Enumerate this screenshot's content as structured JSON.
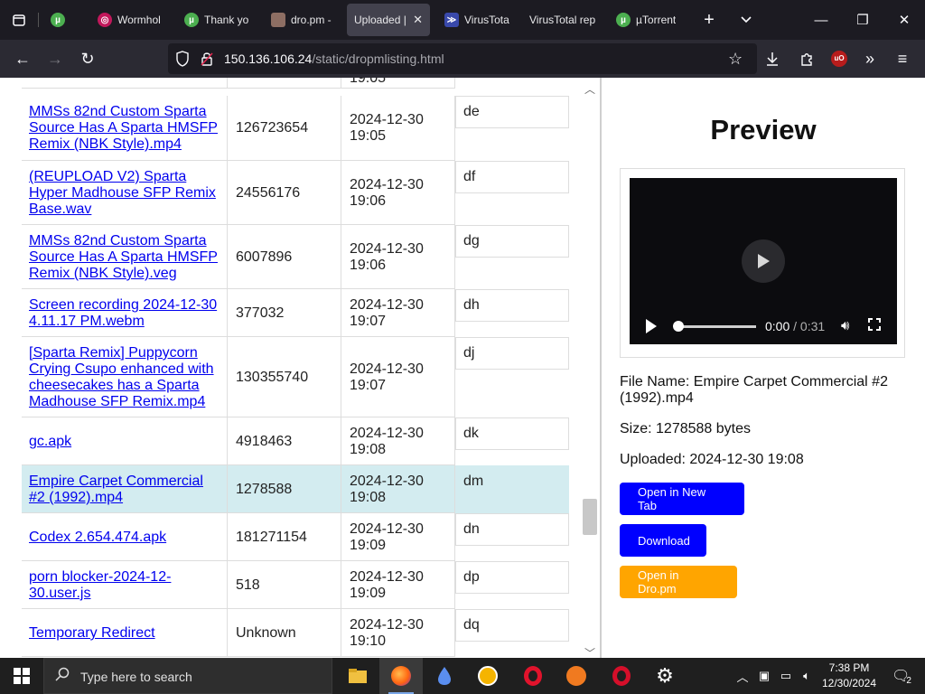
{
  "browser": {
    "tabs": [
      {
        "label": "",
        "icon": "utorrent-icon"
      },
      {
        "label": "Wormhol",
        "icon": "wormhole-icon"
      },
      {
        "label": "Thank yo",
        "icon": "utorrent-icon"
      },
      {
        "label": "dro.pm -",
        "icon": "dro-icon"
      },
      {
        "label": "Uploaded |",
        "icon": "",
        "active": true
      },
      {
        "label": "VirusTotal",
        "icon": "virustotal-icon"
      },
      {
        "label": "VirusTotal rep",
        "icon": ""
      },
      {
        "label": "µTorrent",
        "icon": "utorrent-icon"
      }
    ],
    "url": {
      "host": "150.136.106.24",
      "path": "/static/dropmlisting.html"
    }
  },
  "listing": {
    "partial_top": {
      "date": "19:05"
    },
    "rows": [
      {
        "name": "MMSs 82nd Custom Sparta Source Has A Sparta HMSFP Remix (NBK Style).mp4",
        "size": "126723654",
        "date": "2024-12-30 19:05",
        "id": "de"
      },
      {
        "name": "(REUPLOAD V2) Sparta Hyper Madhouse SFP Remix Base.wav",
        "size": "24556176",
        "date": "2024-12-30 19:06",
        "id": "df"
      },
      {
        "name": "MMSs 82nd Custom Sparta Source Has A Sparta HMSFP Remix (NBK Style).veg",
        "size": "6007896",
        "date": "2024-12-30 19:06",
        "id": "dg"
      },
      {
        "name": "Screen recording 2024-12-30 4.11.17 PM.webm",
        "size": "377032",
        "date": "2024-12-30 19:07",
        "id": "dh"
      },
      {
        "name": "[Sparta Remix] Puppycorn Crying Csupo enhanced with cheesecakes has a Sparta Madhouse SFP Remix.mp4",
        "size": "130355740",
        "date": "2024-12-30 19:07",
        "id": "dj"
      },
      {
        "name": "gc.apk",
        "size": "4918463",
        "date": "2024-12-30 19:08",
        "id": "dk"
      },
      {
        "name": "Empire Carpet Commercial #2 (1992).mp4",
        "size": "1278588",
        "date": "2024-12-30 19:08",
        "id": "dm",
        "selected": true
      },
      {
        "name": "Codex 2.654.474.apk",
        "size": "181271154",
        "date": "2024-12-30 19:09",
        "id": "dn"
      },
      {
        "name": "porn blocker-2024-12-30.user.js",
        "size": "518",
        "date": "2024-12-30 19:09",
        "id": "dp"
      },
      {
        "name": "Temporary Redirect",
        "size": "Unknown",
        "date": "2024-12-30 19:10",
        "id": "dq"
      }
    ]
  },
  "preview": {
    "title": "Preview",
    "video": {
      "current": "0:00",
      "separator": "/",
      "duration": "0:31",
      "progress": 0
    },
    "file_name": "File Name: Empire Carpet Commercial #2 (1992).mp4",
    "size": "Size: 1278588 bytes",
    "uploaded": "Uploaded: 2024-12-30 19:08",
    "buttons": {
      "open_new_tab": "Open in New Tab",
      "download": "Download",
      "open_dro": "Open in Dro.pm"
    },
    "colors": {
      "primary": "#0000ff",
      "secondary": "#ffa500",
      "selected_row": "#d3ecf0"
    }
  },
  "taskbar": {
    "search_placeholder": "Type here to search",
    "time": "7:38 PM",
    "date": "12/30/2024",
    "notification_count": "2"
  }
}
